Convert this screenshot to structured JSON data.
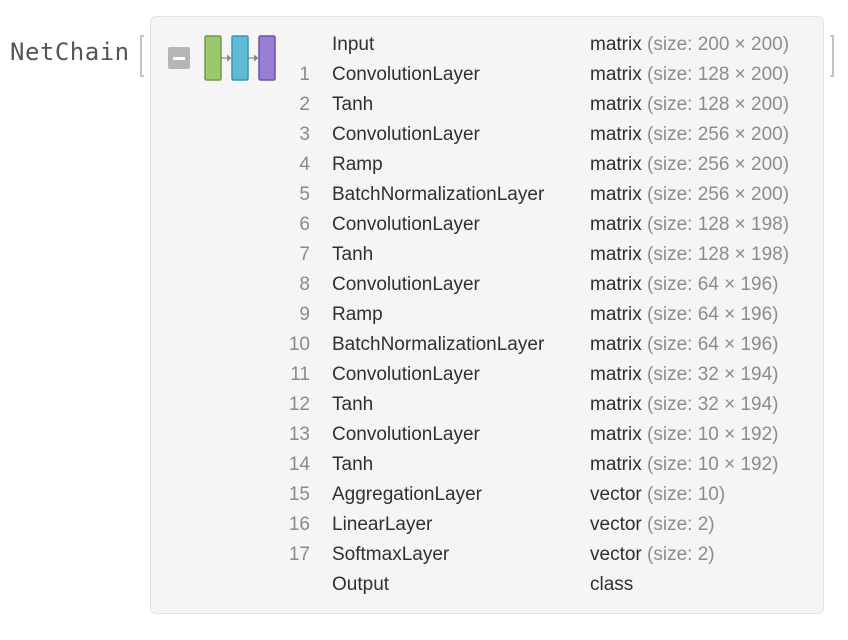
{
  "head": "NetChain",
  "icons": {
    "collapse": "minus-icon",
    "network": "net-chain-layers-icon"
  },
  "colors": {
    "block1": "#9bc86e",
    "block2": "#5fbcd8",
    "block3": "#9a7ed6",
    "arrow": "#888888"
  },
  "rows": [
    {
      "num": "",
      "layer": "Input",
      "kind": "matrix",
      "size": "(size: 200 × 200)"
    },
    {
      "num": "1",
      "layer": "ConvolutionLayer",
      "kind": "matrix",
      "size": "(size: 128 × 200)"
    },
    {
      "num": "2",
      "layer": "Tanh",
      "kind": "matrix",
      "size": "(size: 128 × 200)"
    },
    {
      "num": "3",
      "layer": "ConvolutionLayer",
      "kind": "matrix",
      "size": "(size: 256 × 200)"
    },
    {
      "num": "4",
      "layer": "Ramp",
      "kind": "matrix",
      "size": "(size: 256 × 200)"
    },
    {
      "num": "5",
      "layer": "BatchNormalizationLayer",
      "kind": "matrix",
      "size": "(size: 256 × 200)"
    },
    {
      "num": "6",
      "layer": "ConvolutionLayer",
      "kind": "matrix",
      "size": "(size: 128 × 198)"
    },
    {
      "num": "7",
      "layer": "Tanh",
      "kind": "matrix",
      "size": "(size: 128 × 198)"
    },
    {
      "num": "8",
      "layer": "ConvolutionLayer",
      "kind": "matrix",
      "size": "(size: 64 × 196)"
    },
    {
      "num": "9",
      "layer": "Ramp",
      "kind": "matrix",
      "size": "(size: 64 × 196)"
    },
    {
      "num": "10",
      "layer": "BatchNormalizationLayer",
      "kind": "matrix",
      "size": "(size: 64 × 196)"
    },
    {
      "num": "11",
      "layer": "ConvolutionLayer",
      "kind": "matrix",
      "size": "(size: 32 × 194)"
    },
    {
      "num": "12",
      "layer": "Tanh",
      "kind": "matrix",
      "size": "(size: 32 × 194)"
    },
    {
      "num": "13",
      "layer": "ConvolutionLayer",
      "kind": "matrix",
      "size": "(size: 10 × 192)"
    },
    {
      "num": "14",
      "layer": "Tanh",
      "kind": "matrix",
      "size": "(size: 10 × 192)"
    },
    {
      "num": "15",
      "layer": "AggregationLayer",
      "kind": "vector",
      "size": "(size: 10)"
    },
    {
      "num": "16",
      "layer": "LinearLayer",
      "kind": "vector",
      "size": "(size: 2)"
    },
    {
      "num": "17",
      "layer": "SoftmaxLayer",
      "kind": "vector",
      "size": "(size: 2)"
    },
    {
      "num": "",
      "layer": "Output",
      "kind": "class",
      "size": ""
    }
  ]
}
